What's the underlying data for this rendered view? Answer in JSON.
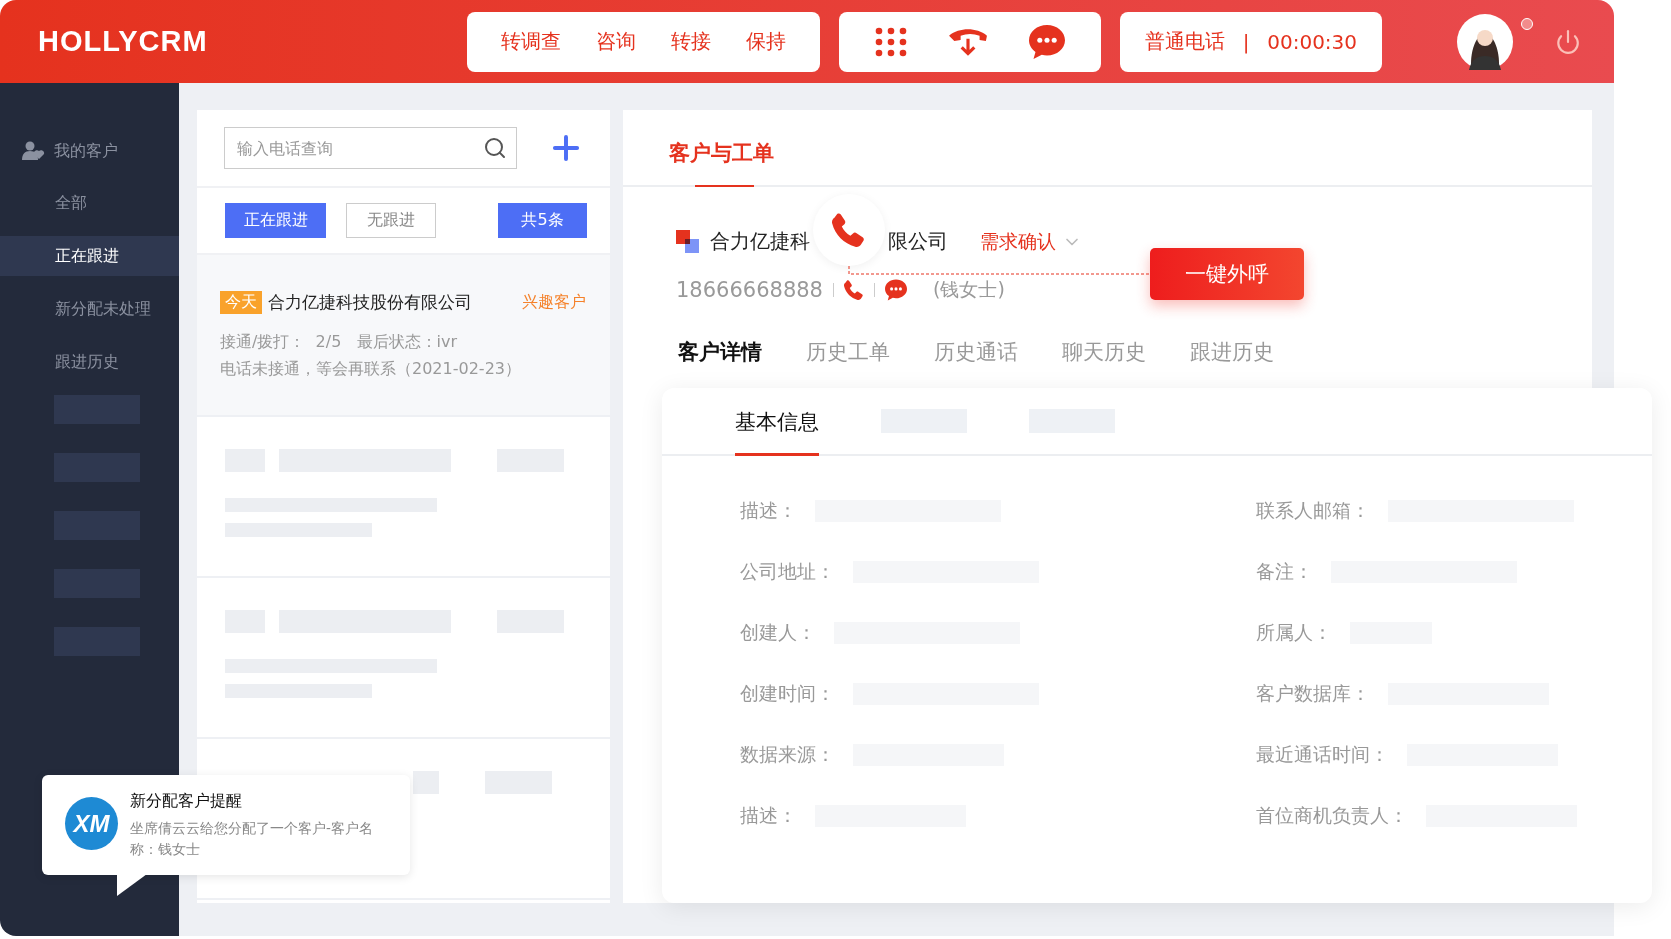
{
  "header": {
    "logo": "HOLLYCRM",
    "actions": [
      "转调查",
      "咨询",
      "转接",
      "保持"
    ],
    "call_type": "普通电话",
    "separator": "|",
    "timer": "00:00:30",
    "unread": true
  },
  "sidebar": {
    "section": "我的客户",
    "items": [
      {
        "kind": "link",
        "label": "全部",
        "selected": false
      },
      {
        "kind": "link",
        "label": "正在跟进",
        "selected": true
      },
      {
        "kind": "link",
        "label": "新分配未处理",
        "selected": false
      },
      {
        "kind": "link",
        "label": "跟进历史",
        "selected": false
      },
      {
        "kind": "placeholder"
      },
      {
        "kind": "placeholder"
      },
      {
        "kind": "placeholder"
      },
      {
        "kind": "placeholder"
      },
      {
        "kind": "placeholder"
      }
    ]
  },
  "list": {
    "search": {
      "placeholder": "输入电话查询"
    },
    "filters": [
      {
        "label": "正在跟进",
        "selected": true
      },
      {
        "label": "无跟进",
        "selected": false
      }
    ],
    "count": "共5条",
    "cards": [
      {
        "kind": "customer",
        "badge": "今天",
        "name": "合力亿捷科技股份有限公司",
        "tag": "兴趣客户",
        "stats": "接通/拨打：  2/5   最后状态：ivr",
        "note": "电话未接通，等会再联系（2021-02-23）"
      },
      {
        "kind": "placeholder"
      },
      {
        "kind": "placeholder"
      },
      {
        "kind": "placeholder_covered"
      }
    ]
  },
  "detail": {
    "tab": "客户与工单",
    "company_start": "合力亿捷科",
    "company_end": "限公司",
    "status": "需求确认",
    "phone": "18666668888",
    "contact": "(钱女士)",
    "call_button": "一键外呼",
    "tabs": [
      {
        "label": "客户详情",
        "selected": true
      },
      {
        "label": "历史工单",
        "selected": false
      },
      {
        "label": "历史通话",
        "selected": false
      },
      {
        "label": "聊天历史",
        "selected": false
      },
      {
        "label": "跟进历史",
        "selected": false
      }
    ],
    "info": {
      "tabs": [
        {
          "label": "基本信息",
          "selected": true
        }
      ],
      "tab_placeholders": [
        {
          "kind": "placeholder"
        },
        {
          "kind": "placeholder"
        }
      ],
      "fields": [
        {
          "label": "描述："
        },
        {
          "label": "联系人邮箱："
        },
        {
          "label": "公司地址："
        },
        {
          "label": "备注："
        },
        {
          "label": "创建人："
        },
        {
          "label": "所属人："
        },
        {
          "label": "创建时间："
        },
        {
          "label": "客户数据库："
        },
        {
          "label": "数据来源："
        },
        {
          "label": "最近通话时间："
        },
        {
          "label": "描述："
        },
        {
          "label": "首位商机负责人："
        }
      ]
    }
  },
  "notification": {
    "logo": "XM",
    "title": "新分配客户提醒",
    "body": "坐席倩云云给您分配了一个客户-客户名称：钱女士"
  }
}
